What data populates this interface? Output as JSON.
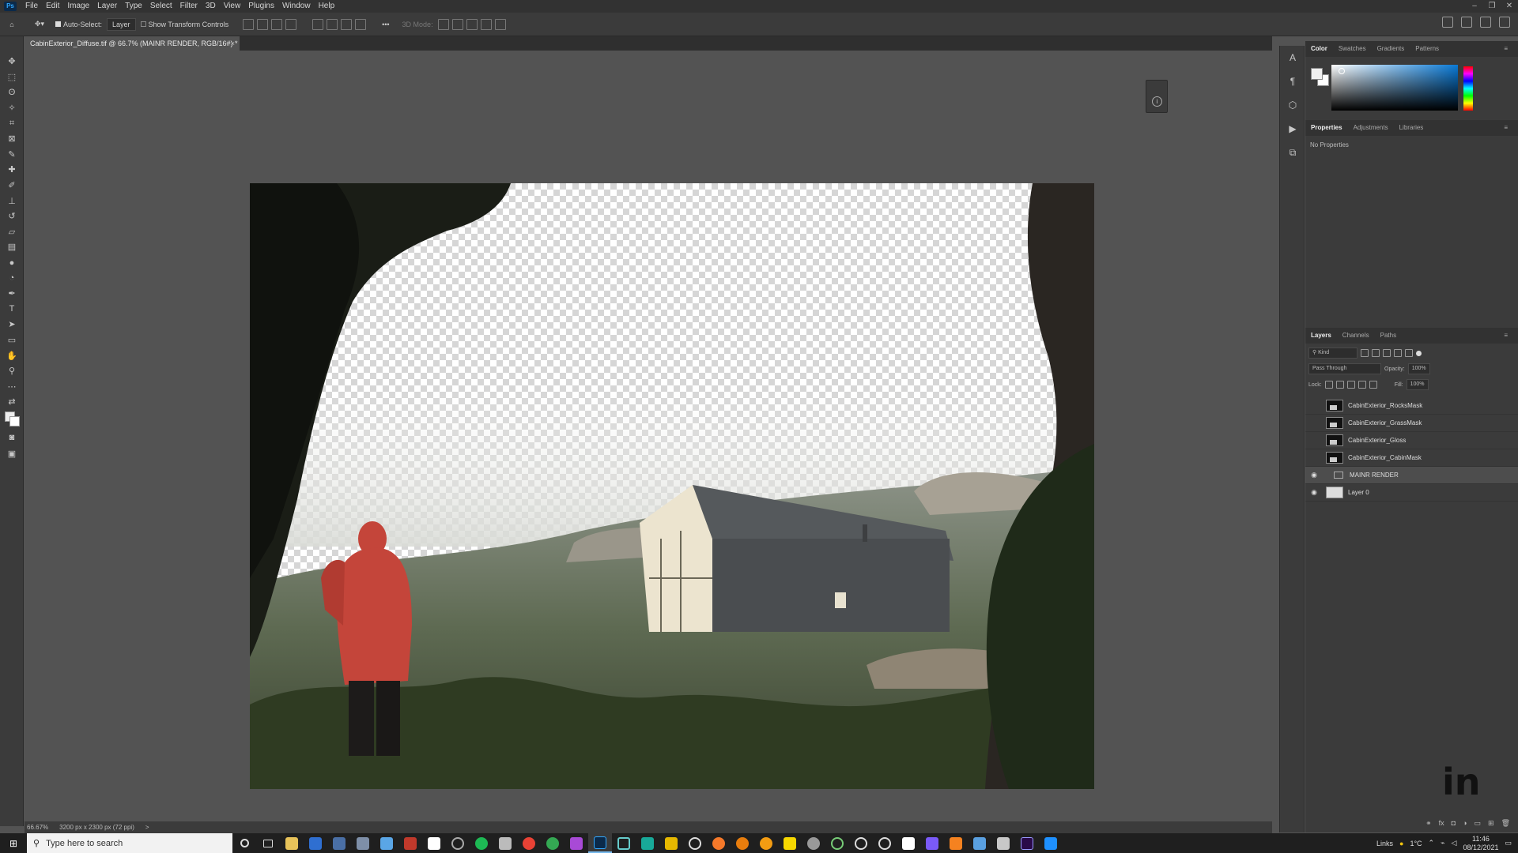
{
  "menubar": {
    "items": [
      "File",
      "Edit",
      "Image",
      "Layer",
      "Type",
      "Select",
      "Filter",
      "3D",
      "View",
      "Plugins",
      "Window",
      "Help"
    ]
  },
  "options": {
    "auto_select": "Auto-Select:",
    "auto_select_target": "Layer",
    "transform_controls": "Show Transform Controls",
    "mode_3d": "3D Mode:"
  },
  "document": {
    "tab_title": "CabinExterior_Diffuse.tif @ 66.7% (MAINR RENDER, RGB/16#) *",
    "close": "×"
  },
  "status": {
    "zoom": "66.67%",
    "size": "3200 px x 2300 px (72 ppi)",
    "more": ">"
  },
  "color_panel": {
    "tabs": [
      "Color",
      "Swatches",
      "Gradients",
      "Patterns"
    ],
    "active_tab": "Color"
  },
  "properties_panel": {
    "tabs": [
      "Properties",
      "Adjustments",
      "Libraries"
    ],
    "empty_text": "No Properties"
  },
  "layers_panel": {
    "tabs": [
      "Layers",
      "Channels",
      "Paths"
    ],
    "kind_label": "Kind",
    "blend_mode": "Pass Through",
    "opacity_label": "Opacity:",
    "opacity_value": "100%",
    "lock_label": "Lock:",
    "fill_label": "Fill:",
    "fill_value": "100%",
    "layers": [
      {
        "name": "CabinExterior_RocksMask",
        "visible": false,
        "selected": false,
        "group": false
      },
      {
        "name": "CabinExterior_GrassMask",
        "visible": false,
        "selected": false,
        "group": false
      },
      {
        "name": "CabinExterior_Gloss",
        "visible": false,
        "selected": false,
        "group": false
      },
      {
        "name": "CabinExterior_CabinMask",
        "visible": false,
        "selected": false,
        "group": false
      },
      {
        "name": "MAINR RENDER",
        "visible": true,
        "selected": true,
        "group": true
      },
      {
        "name": "Layer 0",
        "visible": true,
        "selected": false,
        "group": false
      }
    ]
  },
  "taskbar": {
    "search_placeholder": "Type here to search",
    "links": "Links",
    "temperature": "1°C",
    "time": "11:46",
    "date": "08/12/2021"
  },
  "colors": {
    "accent": "#31a8ff",
    "panel": "#3b3b3b",
    "canvas_bg": "#535353"
  }
}
